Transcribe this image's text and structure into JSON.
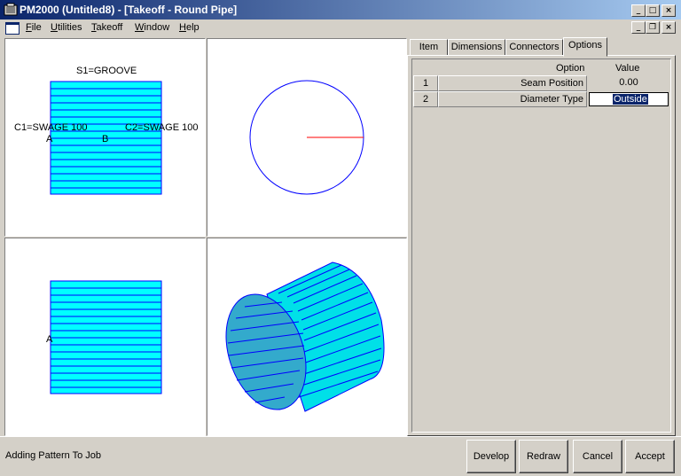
{
  "window": {
    "title": "PM2000 (Untitled8) - [Takeoff - Round Pipe]",
    "icon": "app-icon",
    "controls": {
      "minimize": "_",
      "maximize": "□",
      "close": "×"
    }
  },
  "menubar": {
    "items": [
      {
        "label": "File",
        "accel": "F"
      },
      {
        "label": "Utilities",
        "accel": "U"
      },
      {
        "label": "Takeoff",
        "accel": "T"
      },
      {
        "label": "Window",
        "accel": "W"
      },
      {
        "label": "Help",
        "accel": "H"
      }
    ],
    "mdi_controls": {
      "minimize": "_",
      "restore": "❐",
      "close": "×"
    }
  },
  "views": {
    "front": {
      "s1_label": "S1=GROOVE",
      "c1_label": "C1=SWAGE 100",
      "c2_label": "C2=SWAGE 100",
      "point_a": "A",
      "point_b": "B"
    },
    "bottom": {
      "point_a": "A"
    },
    "fill_color": "#00ffff",
    "line_color": "#0000ff",
    "radius_color": "#ff0000"
  },
  "tabs": [
    {
      "label": "Item",
      "active": false
    },
    {
      "label": "Dimensions",
      "active": false
    },
    {
      "label": "Connectors",
      "active": false
    },
    {
      "label": "Options",
      "active": true
    }
  ],
  "options_grid": {
    "header_option": "Option",
    "header_value": "Value",
    "rows": [
      {
        "num": "1",
        "option": "Seam Position",
        "value": "0.00"
      },
      {
        "num": "2",
        "option": "Diameter Type",
        "value": "Outside"
      }
    ]
  },
  "status": {
    "text": "Adding Pattern To Job"
  },
  "buttons": {
    "develop": "Develop",
    "redraw": "Redraw",
    "cancel": "Cancel",
    "accept": "Accept"
  }
}
